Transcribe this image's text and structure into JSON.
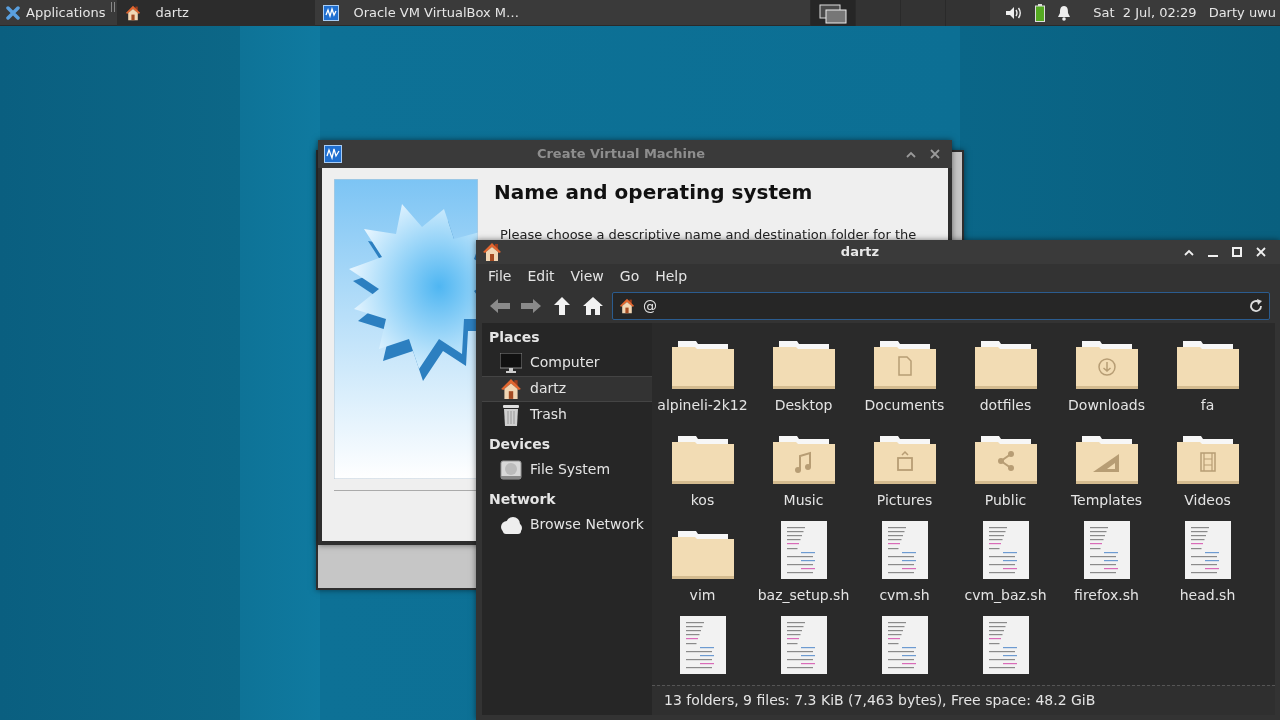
{
  "taskbar": {
    "menu_button": "Applications",
    "tasks": [
      {
        "label": "dartz",
        "kind": "files",
        "selected": true
      },
      {
        "label": "Oracle VM VirtualBox M…",
        "kind": "virtualbox",
        "selected": false
      }
    ],
    "workspaces": [
      {
        "selected": true
      },
      {
        "selected": false
      },
      {
        "selected": false
      },
      {
        "selected": false
      }
    ],
    "clock": "Sat  2 Jul, 02:29",
    "user": "Darty uwu"
  },
  "dialog": {
    "title": "Create Virtual Machine",
    "active": false,
    "buttons": [
      {
        "kind": "shade"
      },
      {
        "kind": "close"
      }
    ],
    "heading": "Name and operating system",
    "text": "Please choose a descriptive name and destination folder for the"
  },
  "file_manager": {
    "title": "dartz",
    "active": true,
    "buttons": [
      {
        "kind": "shade"
      },
      {
        "kind": "minimize"
      },
      {
        "kind": "maximize"
      },
      {
        "kind": "close"
      }
    ],
    "menu": [
      "File",
      "Edit",
      "View",
      "Go",
      "Help"
    ],
    "toolbar": [
      {
        "kind": "back",
        "disabled": true
      },
      {
        "kind": "forward",
        "disabled": true
      },
      {
        "kind": "up",
        "disabled": false
      },
      {
        "kind": "home",
        "disabled": false
      }
    ],
    "location": "@",
    "sidebar": [
      {
        "heading": "Places",
        "items": [
          {
            "label": "Computer",
            "kind": "computer",
            "selected": false
          },
          {
            "label": "dartz",
            "kind": "home",
            "selected": true
          },
          {
            "label": "Trash",
            "kind": "trash",
            "selected": false
          }
        ]
      },
      {
        "heading": "Devices",
        "items": [
          {
            "label": "File System",
            "kind": "drive",
            "selected": false
          }
        ]
      },
      {
        "heading": "Network",
        "items": [
          {
            "label": "Browse Network",
            "kind": "network",
            "selected": false
          }
        ]
      }
    ],
    "files": [
      {
        "name": "alpineli-2k12",
        "kind": "folder"
      },
      {
        "name": "Desktop",
        "kind": "folder"
      },
      {
        "name": "Documents",
        "kind": "documents"
      },
      {
        "name": "dotfiles",
        "kind": "folder"
      },
      {
        "name": "Downloads",
        "kind": "downloads"
      },
      {
        "name": "fa",
        "kind": "folder"
      },
      {
        "name": "kos",
        "kind": "folder"
      },
      {
        "name": "Music",
        "kind": "music"
      },
      {
        "name": "Pictures",
        "kind": "pictures"
      },
      {
        "name": "Public",
        "kind": "public"
      },
      {
        "name": "Templates",
        "kind": "templates"
      },
      {
        "name": "Videos",
        "kind": "videos"
      },
      {
        "name": "vim",
        "kind": "folder"
      },
      {
        "name": "baz_setup.sh",
        "kind": "script"
      },
      {
        "name": "cvm.sh",
        "kind": "script"
      },
      {
        "name": "cvm_baz.sh",
        "kind": "script"
      },
      {
        "name": "firefox.sh",
        "kind": "script"
      },
      {
        "name": "head.sh",
        "kind": "script"
      },
      {
        "kind": "script"
      },
      {
        "kind": "script"
      },
      {
        "kind": "script"
      },
      {
        "kind": "script"
      }
    ],
    "status_bar": "13 folders, 9 files: 7.3 KiB (7,463 bytes), Free space: 48.2 GiB"
  }
}
